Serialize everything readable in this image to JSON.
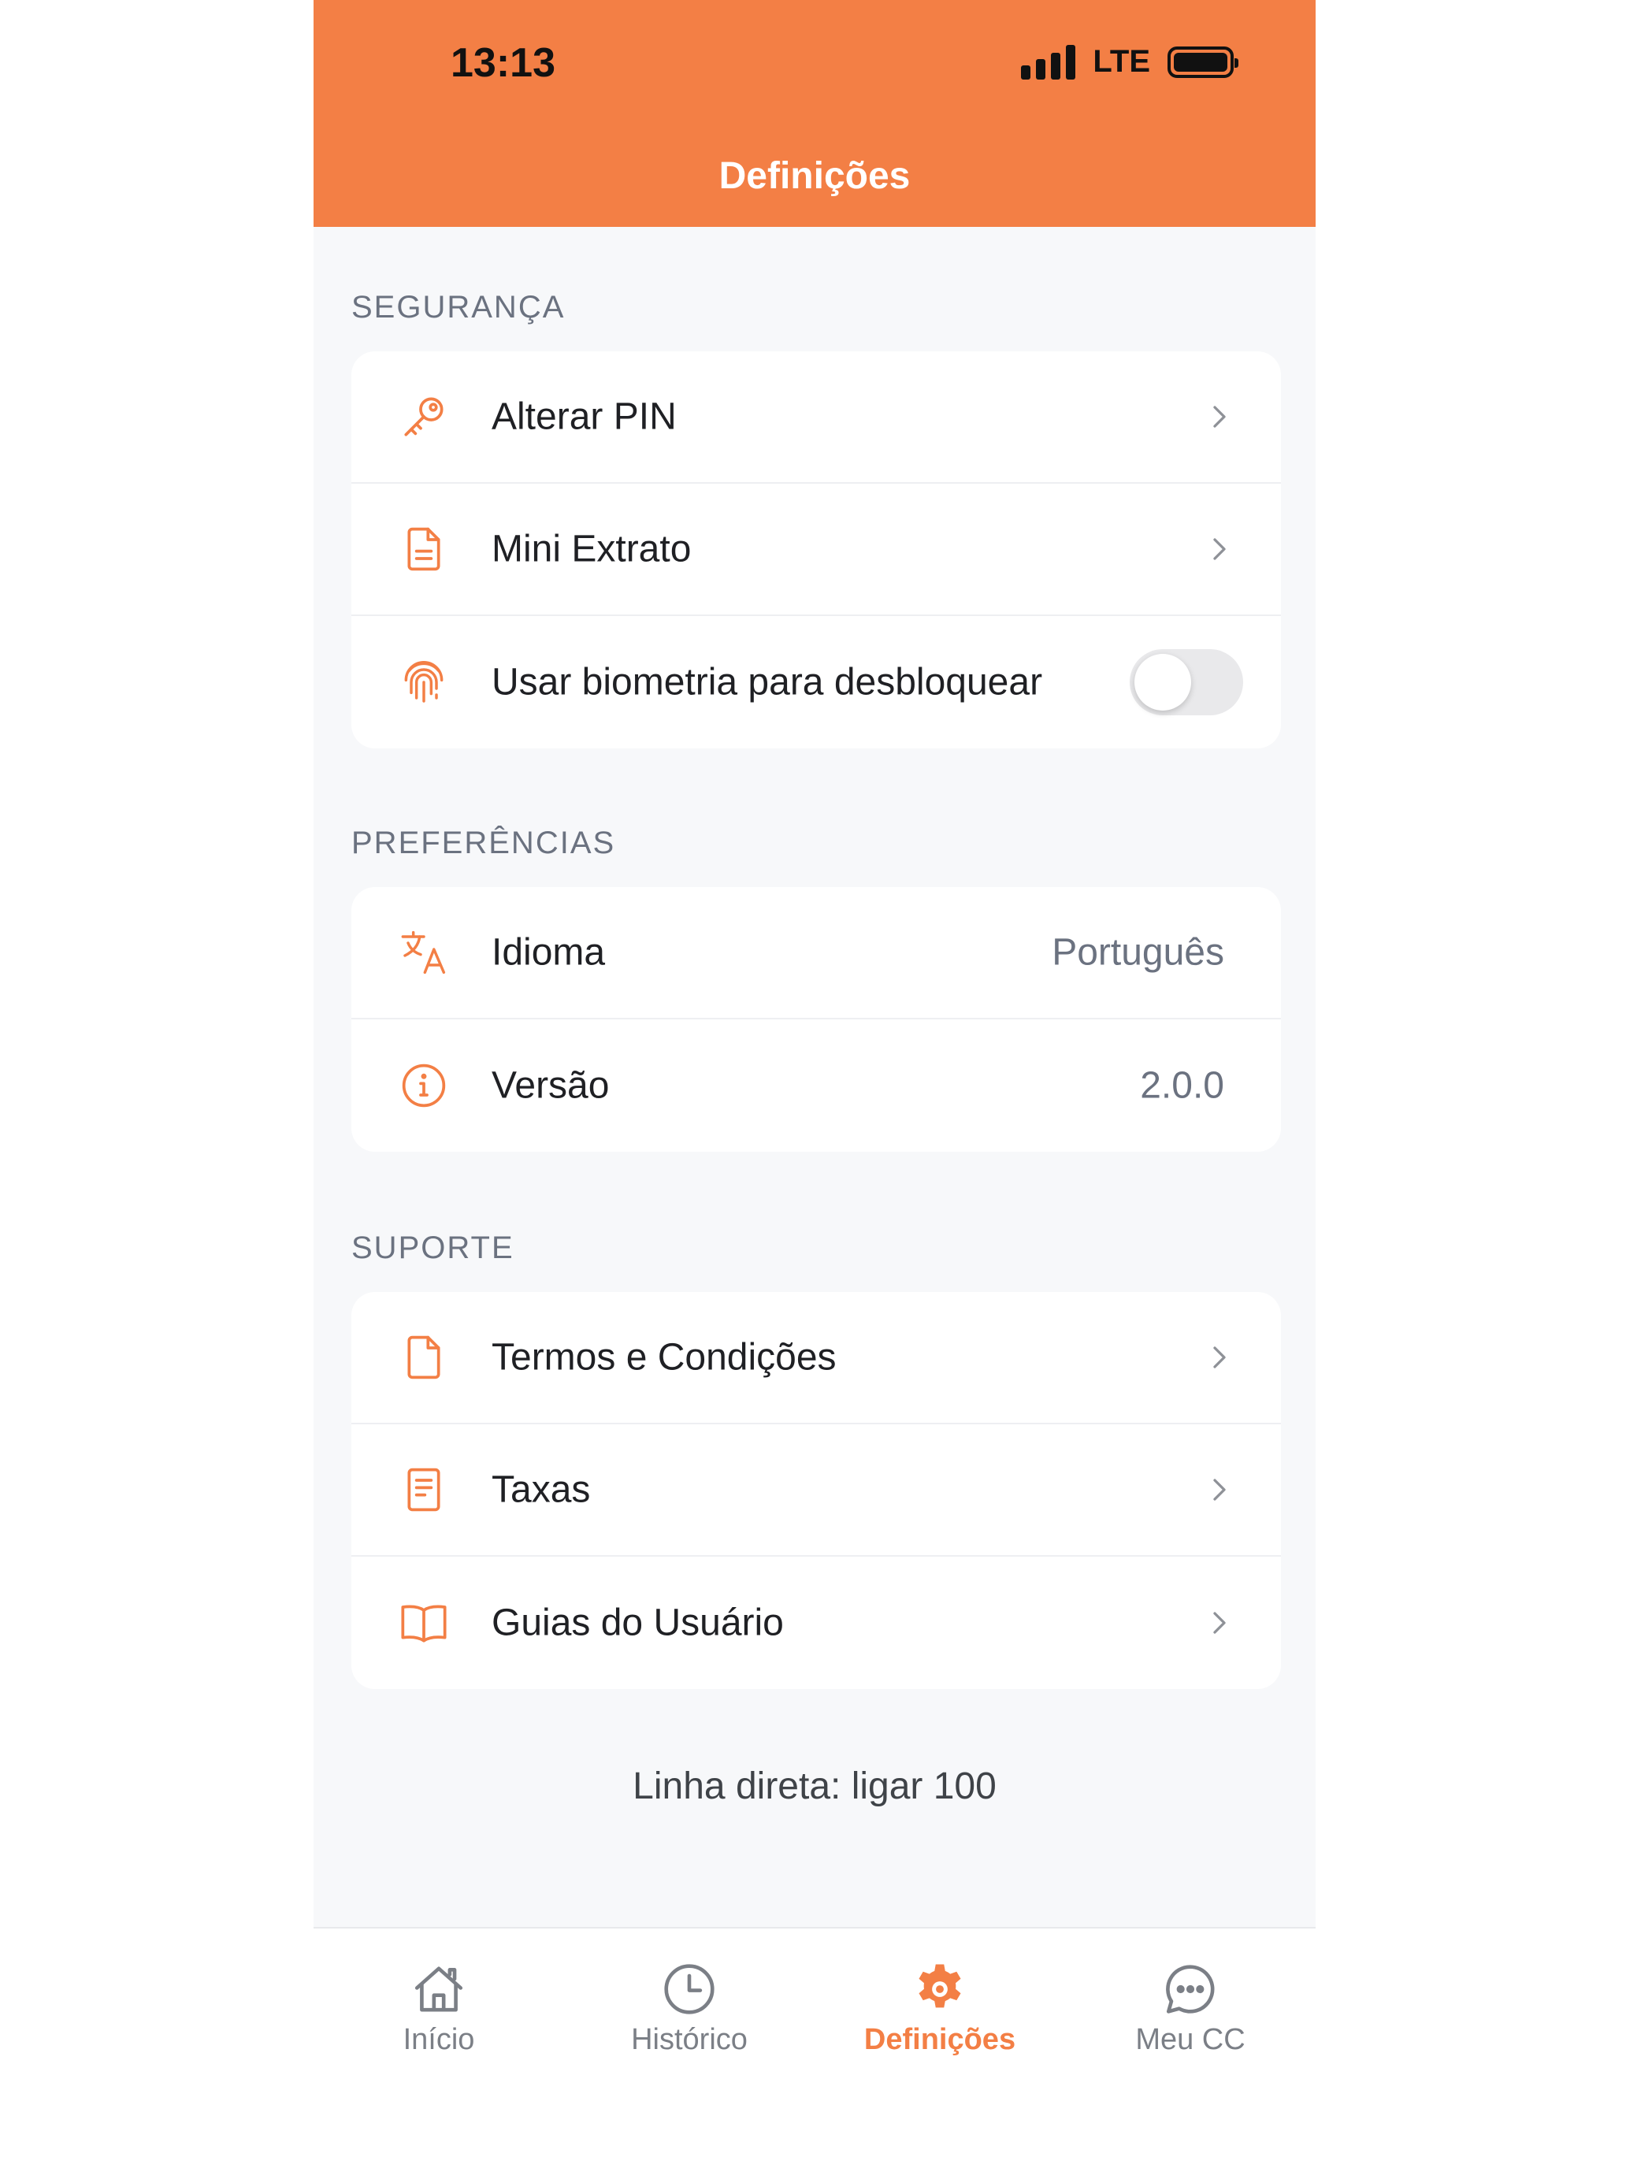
{
  "status_bar": {
    "time": "13:13",
    "network": "LTE"
  },
  "header": {
    "title": "Definições",
    "color": "#f37f45"
  },
  "sections": [
    {
      "label": "SEGURANÇA",
      "items": [
        {
          "icon": "key-icon",
          "label": "Alterar PIN"
        },
        {
          "icon": "document-icon",
          "label": "Mini Extrato"
        },
        {
          "icon": "fingerprint-icon",
          "label": "Usar biometria para desbloquear",
          "toggle": false
        }
      ]
    },
    {
      "label": "PREFERÊNCIAS",
      "items": [
        {
          "icon": "translate-icon",
          "label": "Idioma",
          "value": "Português"
        },
        {
          "icon": "info-icon",
          "label": "Versão",
          "value": "2.0.0"
        }
      ]
    },
    {
      "label": "SUPORTE",
      "items": [
        {
          "icon": "file-icon",
          "label": "Termos e Condições"
        },
        {
          "icon": "receipt-icon",
          "label": "Taxas"
        },
        {
          "icon": "book-icon",
          "label": "Guias do Usuário"
        }
      ]
    }
  ],
  "hotline": "Linha direta: ligar 100",
  "tabbar": {
    "tabs": [
      {
        "icon": "home-icon",
        "label": "Início"
      },
      {
        "icon": "clock-icon",
        "label": "Histórico"
      },
      {
        "icon": "gear-icon",
        "label": "Definições",
        "active": true
      },
      {
        "icon": "chat-icon",
        "label": "Meu CC"
      }
    ]
  }
}
